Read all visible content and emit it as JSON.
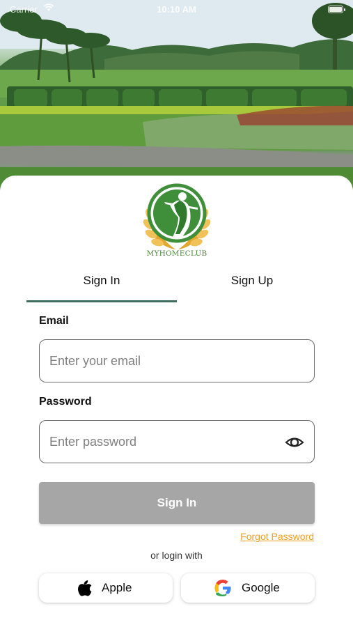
{
  "status_bar": {
    "carrier": "Carrier",
    "time": "10:10 AM"
  },
  "hero": {
    "description_icon": "golf-course-photo"
  },
  "logo": {
    "text": "MYHOMECLUB",
    "icon": "golfer-wreath-logo-icon",
    "colors": {
      "green": "#3f8f3a",
      "gold": "#e2a72e"
    }
  },
  "tabs": [
    {
      "label": "Sign In",
      "selected": true
    },
    {
      "label": "Sign Up",
      "selected": false
    }
  ],
  "form": {
    "email": {
      "label": "Email",
      "placeholder": "Enter your email",
      "value": ""
    },
    "password": {
      "label": "Password",
      "placeholder": "Enter password",
      "value": ""
    }
  },
  "actions": {
    "signin_label": "Sign In",
    "forgot_label": "Forgot Password",
    "or_login_with": "or login with"
  },
  "social": {
    "apple_label": "Apple",
    "google_label": "Google"
  },
  "colors": {
    "tab_indicator": "#3f6e5d",
    "signin_button_bg": "#a6a6a6",
    "forgot_link": "#f0a020"
  }
}
